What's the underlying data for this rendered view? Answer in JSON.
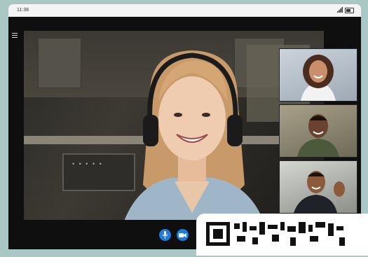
{
  "status_bar": {
    "time": "11:38",
    "icons": [
      "signal-icon",
      "battery-icon"
    ]
  },
  "call": {
    "menu_icon": "hamburger-menu-icon",
    "main_participant": "participant-main",
    "participants": [
      {
        "id": "participant-1"
      },
      {
        "id": "participant-2"
      },
      {
        "id": "participant-3"
      }
    ],
    "controls": [
      {
        "name": "mic-button",
        "icon": "microphone-icon"
      },
      {
        "name": "camera-button",
        "icon": "video-camera-icon"
      }
    ],
    "accent_color": "#1e7be0"
  }
}
